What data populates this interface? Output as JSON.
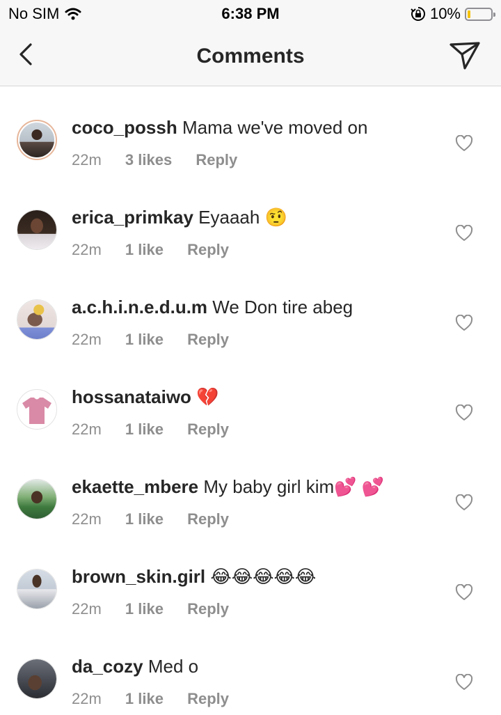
{
  "status_bar": {
    "carrier": "No SIM",
    "time": "6:38 PM",
    "battery": "10%",
    "battery_color": "#f4c20d"
  },
  "nav": {
    "title": "Comments",
    "back_icon": "chevron-left-icon",
    "send_icon": "paper-plane-icon"
  },
  "comments": [
    {
      "username": "coco_possh",
      "text": "Mama we've moved on",
      "time": "22m",
      "likes": "3 likes",
      "reply": "Reply"
    },
    {
      "username": "erica_primkay",
      "text": "Eyaaah 🤨",
      "time": "22m",
      "likes": "1 like",
      "reply": "Reply"
    },
    {
      "username": "a.c.h.i.n.e.d.u.m",
      "text": "We Don tire abeg",
      "time": "22m",
      "likes": "1 like",
      "reply": "Reply"
    },
    {
      "username": "hossanataiwo",
      "text": "💔",
      "time": "22m",
      "likes": "1 like",
      "reply": "Reply"
    },
    {
      "username": "ekaette_mbere",
      "text": "My baby girl kim💕 💕",
      "time": "22m",
      "likes": "1 like",
      "reply": "Reply"
    },
    {
      "username": "brown_skin.girl",
      "text": "😂😂😂😂😂",
      "time": "22m",
      "likes": "1 like",
      "reply": "Reply"
    },
    {
      "username": "da_cozy",
      "text": "Med o",
      "time": "22m",
      "likes": "1 like",
      "reply": "Reply"
    }
  ]
}
